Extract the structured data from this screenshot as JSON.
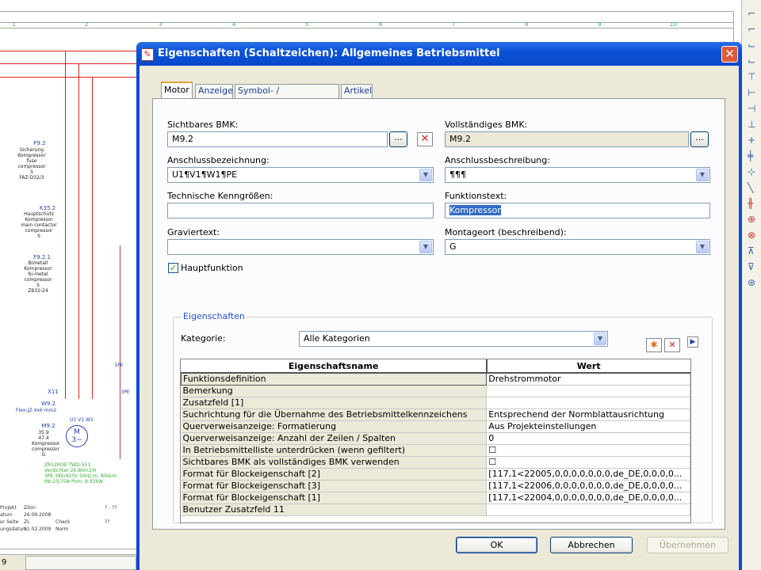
{
  "background": {
    "ruler": [
      "1",
      "2",
      "3",
      "4",
      "5",
      "6",
      "7",
      "8",
      "9",
      "10"
    ],
    "labels": [
      {
        "text": "F9.2",
        "sub": "Sicherung\nKompressor\nfuse\ncompressor\nS\nFAZ-D32/3"
      },
      {
        "text": "K35.2",
        "sub": "Hauptschütz\nKompressor\nmain contactor\ncompressor\nS"
      },
      {
        "text": "F9.2.1",
        "sub": "Bimetall\nKompressor\nbi-metal\ncompressor\nS\nZB32-24"
      },
      {
        "text": "X11",
        "sub": ""
      },
      {
        "text": "W9.2",
        "sub": "Flex-JZ 4x6 mm2"
      },
      {
        "text": "M9.2",
        "sub": "35.9\n47.4\nKompressor\ncompressor\nG"
      }
    ],
    "motor_symbol": "M\n3~",
    "pe": "1PE",
    "pe2": "3PE",
    "motor_terminals": "U1 V1 W1",
    "green_text": [
      "ZR12M3E-TWD-551",
      "Verdichter   26.80m3/h",
      "3PE 380/420V 50Hz,m. Biterm",
      "INr:25/70A Pnm: 9.93kW"
    ],
    "title_block": {
      "rows": [
        "Projekt",
        "atum",
        "er Seite",
        "ungsdatum"
      ],
      "vals": [
        "Zilon",
        "26.09.2008",
        "ZL",
        "11.02.2009"
      ],
      "mid": [
        "",
        "",
        "Check",
        "Norm"
      ],
      "right": [
        "? - ??",
        "",
        "??",
        ""
      ]
    },
    "page_number": "9"
  },
  "dialog": {
    "title": "Eigenschaften (Schaltzeichen): Allgemeines Betriebsmittel",
    "tabs": [
      "Motor",
      "Anzeige",
      "Symbol- / Funktionsdaten",
      "Artikel"
    ],
    "fields": {
      "sichtbares_bmk_label": "Sichtbares BMK:",
      "sichtbares_bmk": "M9.2",
      "vollstaendiges_bmk_label": "Vollständiges BMK:",
      "vollstaendiges_bmk": "M9.2",
      "anschlussbez_label": "Anschlussbezeichnung:",
      "anschlussbez": "U1¶V1¶W1¶PE",
      "anschlussbeschr_label": "Anschlussbeschreibung:",
      "anschlussbeschr": "¶¶¶",
      "tech_label": "Technische Kenngrößen:",
      "tech": "",
      "funktionstext_label": "Funktionstext:",
      "funktionstext": "Kompressor",
      "gravier_label": "Graviertext:",
      "gravier": "",
      "montageort_label": "Montageort (beschreibend):",
      "montageort": "G",
      "hauptfunktion_label": "Hauptfunktion",
      "browse": "...",
      "delete": "✕"
    },
    "properties": {
      "group_title": "Eigenschaften",
      "kategorie_label": "Kategorie:",
      "kategorie": "Alle Kategorien",
      "col_name": "Eigenschaftsname",
      "col_value": "Wert",
      "rows": [
        {
          "name": "Funktionsdefinition",
          "value": "Drehstrommotor"
        },
        {
          "name": "Bemerkung",
          "value": ""
        },
        {
          "name": "Zusatzfeld [1]",
          "value": ""
        },
        {
          "name": "Suchrichtung für die Übernahme des Betriebsmittelkennzeichens",
          "value": "Entsprechend der Normblattausrichtung"
        },
        {
          "name": "Querverweisanzeige: Formatierung",
          "value": "Aus Projekteinstellungen"
        },
        {
          "name": "Querverweisanzeige: Anzahl der Zeilen / Spalten",
          "value": "0"
        },
        {
          "name": "In Betriebsmittelliste unterdrücken (wenn gefiltert)",
          "value": "☐"
        },
        {
          "name": "Sichtbares BMK als vollständiges BMK verwenden",
          "value": "☐"
        },
        {
          "name": "Format für Blockeigenschaft [2]",
          "value": "[117,1<22005,0,0,0,0,0,0,0,de_DE,0,0,0,0..."
        },
        {
          "name": "Format für Blockeigenschaft [3]",
          "value": "[117,1<22006,0,0,0,0,0,0,0,de_DE,0,0,0,0..."
        },
        {
          "name": "Format für Blockeigenschaft [1]",
          "value": "[117,1<22004,0,0,0,0,0,0,0,de_DE,0,0,0,0..."
        },
        {
          "name": "Benutzer Zusatzfeld 11",
          "value": ""
        }
      ]
    },
    "buttons": {
      "ok": "OK",
      "cancel": "Abbrechen",
      "apply": "Übernehmen"
    }
  }
}
